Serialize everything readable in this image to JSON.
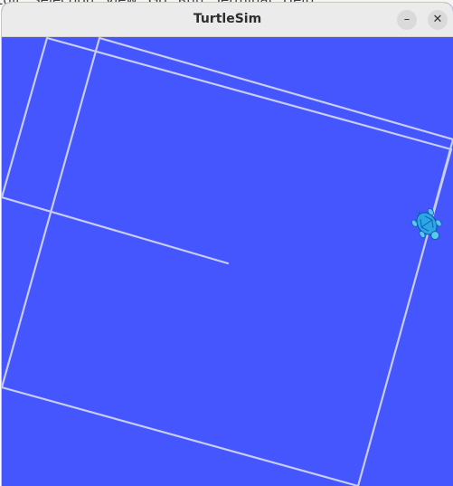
{
  "background_menu": {
    "items": [
      "Edit",
      "Selection",
      "View",
      "Go",
      "Run",
      "Terminal",
      "Help"
    ]
  },
  "window": {
    "title": "TurtleSim",
    "minimize_icon": "minimize-icon",
    "close_icon": "close-icon"
  },
  "canvas": {
    "background_color": "#4556ff",
    "trail_color": "#c8cdf4",
    "turtle_icon": "turtle-icon",
    "turtle_color": "#2ba6e6"
  }
}
